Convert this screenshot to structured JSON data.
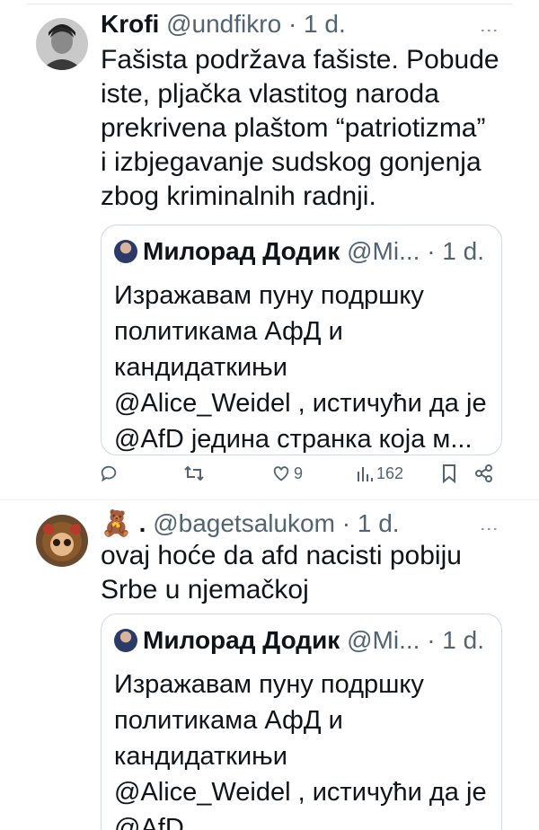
{
  "posts": [
    {
      "display_name": "Krofi",
      "handle": "@undfikro",
      "time": "1 d.",
      "text_lines": [
        "Fašista podržava fašiste. Pobude",
        "iste, pljačka vlastitog naroda",
        "prekrivena plaštom “patriotizma”",
        "i izbjegavanje sudskog gonjenja",
        "zbog kriminalnih radnji."
      ],
      "quote": {
        "display_name": "Милорад Додик",
        "handle": "@Mi...",
        "time": "1 d.",
        "text_lines": [
          "Изражавам пуну подршку",
          "политикама АфД и",
          "кандидаткињи",
          "@Alice_Weidel , истичући да је",
          "@AfD једина странка која м..."
        ]
      },
      "actions": {
        "reply_icon": "reply-icon",
        "retweet_icon": "retweet-icon",
        "likes": "9",
        "views": "162"
      }
    },
    {
      "display_name": "🧸 .",
      "handle": "@bagetsalukom",
      "time": "1 d.",
      "text_lines": [
        "ovaj hoće da afd nacisti pobiju",
        "Srbe u njemačkoj"
      ],
      "quote": {
        "display_name": "Милорад Додик",
        "handle": "@Mi...",
        "time": "1 d.",
        "text_lines": [
          "Изражавам пуну подршку",
          "политикама АфД и",
          "кандидаткињи",
          "@Alice_Weidel , истичући да је",
          "@AfD"
        ]
      }
    }
  ],
  "separator": "·",
  "colors": {
    "text": "#0f1419",
    "muted": "#536471",
    "border": "#cfd9de"
  }
}
